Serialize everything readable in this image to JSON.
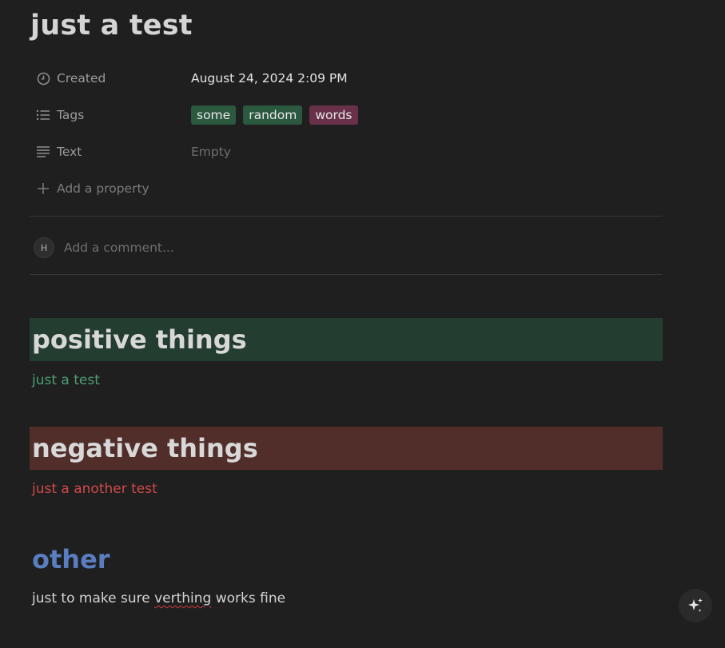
{
  "page": {
    "title": "just a test"
  },
  "properties": [
    {
      "icon": "clock-icon",
      "label": "Created",
      "value": "August 24, 2024 2:09 PM"
    },
    {
      "icon": "list-icon",
      "label": "Tags",
      "tags": [
        {
          "text": "some",
          "color": "#2b5940"
        },
        {
          "text": "random",
          "color": "#2b5940"
        },
        {
          "text": "words",
          "color": "#69304a"
        }
      ]
    },
    {
      "icon": "text-lines-icon",
      "label": "Text",
      "value": "Empty"
    }
  ],
  "add_property": {
    "icon": "plus-icon",
    "label": "Add a property"
  },
  "comment": {
    "avatar_initial": "H",
    "placeholder": "Add a comment..."
  },
  "sections": [
    {
      "heading": "positive things",
      "heading_bg": "#243d31",
      "body": "just a test",
      "body_color": "#4d9e74"
    },
    {
      "heading": "negative things",
      "heading_bg": "#522e2a",
      "body": "just a another test",
      "body_color": "#d04a4a"
    },
    {
      "heading": "other",
      "heading_color": "#5a7dc0",
      "body_before": "just to make sure ",
      "body_misspelled": "verthing",
      "body_after": " works fine"
    }
  ],
  "ai_button": {
    "icon": "sparkle-icon"
  }
}
